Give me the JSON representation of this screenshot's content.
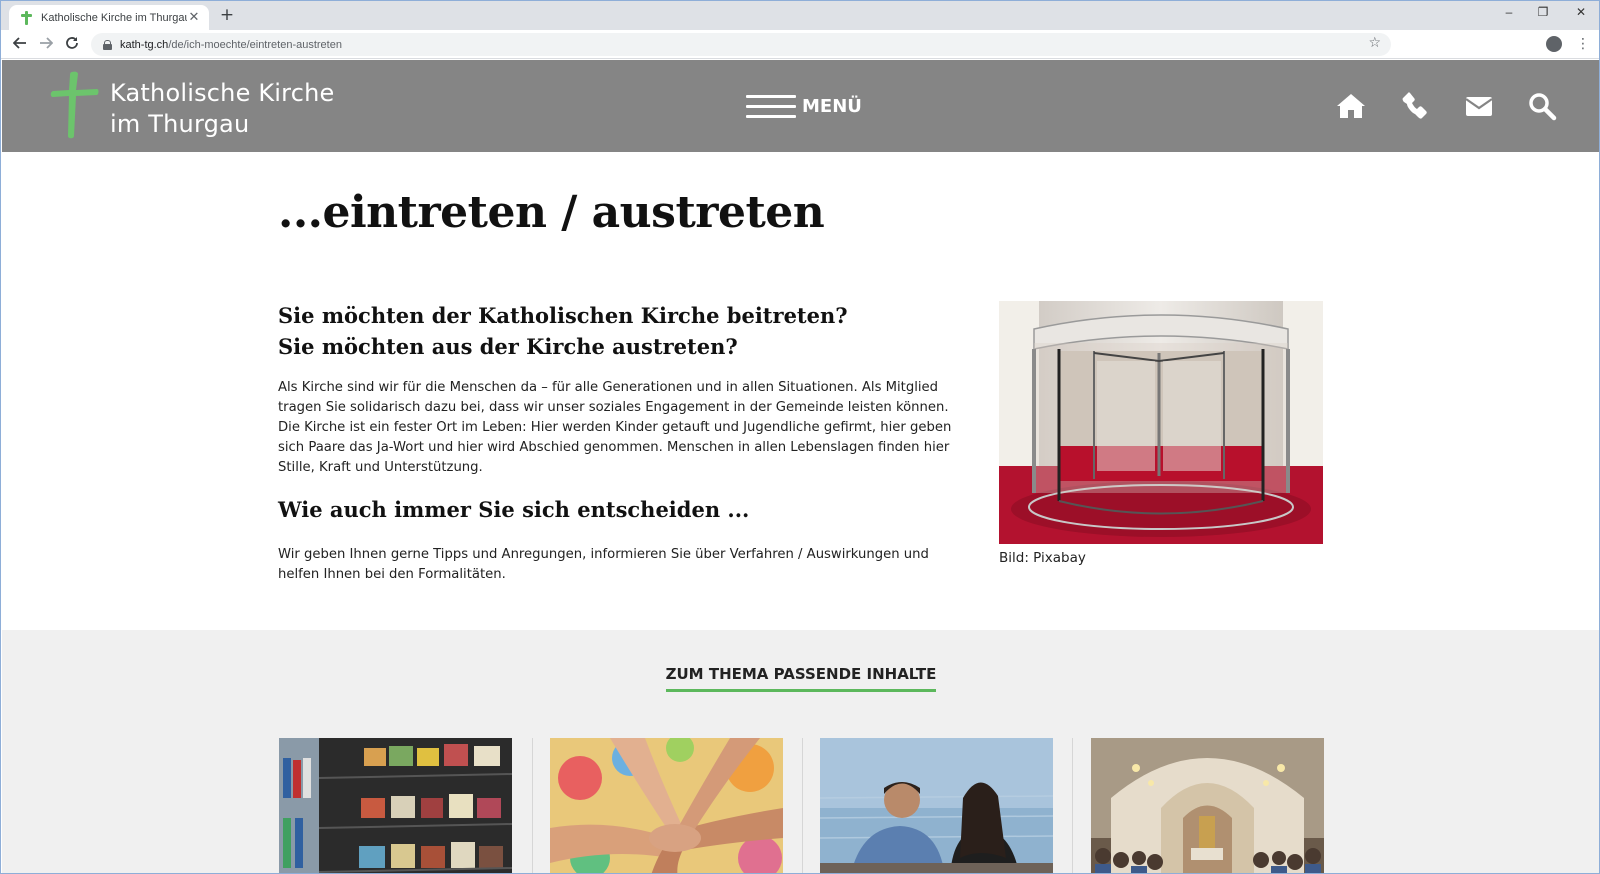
{
  "browser": {
    "tab_title": "Katholische Kirche im Thurgau",
    "tab_close": "✕",
    "new_tab": "+",
    "url_host": "kath-tg.ch",
    "url_path": "/de/ich-moechte/eintreten-austreten",
    "window_controls": {
      "minimize": "–",
      "restore": "❐",
      "close": "✕"
    }
  },
  "header": {
    "logo_line1": "Katholische Kirche",
    "logo_line2": "im Thurgau",
    "menu_label": "MENÜ",
    "icons": [
      "home-icon",
      "phone-icon",
      "mail-icon",
      "search-icon"
    ],
    "background": "#858585",
    "accent": "#6cc46c"
  },
  "main": {
    "title": "...eintreten / austreten",
    "intro_heading_line1": "Sie möchten der Katholischen Kirche beitreten?",
    "intro_heading_line2": "Sie möchten aus der Kirche austreten?",
    "intro_text": "Als Kirche sind wir für die Menschen da – für alle Generationen und in allen Situationen. Als Mitglied tragen Sie solidarisch dazu bei, dass wir unser soziales Engagement in der Gemeinde leisten können. Die Kirche ist ein fester Ort im Leben: Hier werden Kinder getauft und Jugendliche gefirmt, hier geben sich Paare das Ja-Wort und hier wird Abschied genommen. Menschen in allen Lebenslagen finden hier Stille, Kraft und Unterstützung.",
    "sub_heading": "Wie auch immer Sie sich entscheiden ...",
    "sub_text": "Wir geben Ihnen gerne Tipps und Anregungen, informieren Sie über Verfahren / Auswirkungen und helfen Ihnen bei den Formalitäten.",
    "image_caption": "Bild: Pixabay"
  },
  "related": {
    "title": "ZUM THEMA PASSENDE INHALTE",
    "accent": "#5cb85c"
  }
}
